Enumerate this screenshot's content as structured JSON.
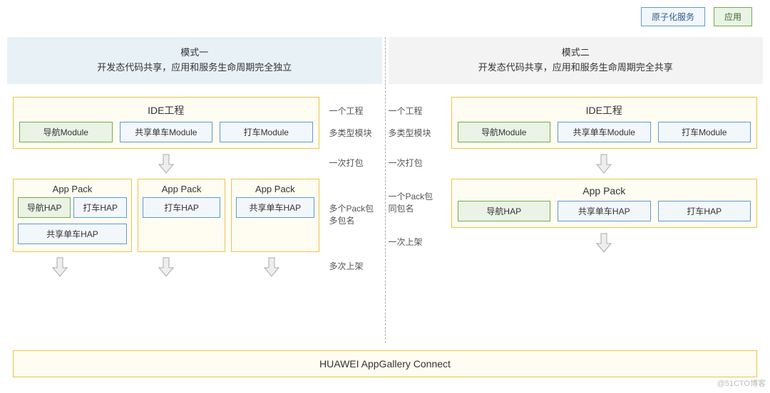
{
  "legend": {
    "atomic": "原子化服务",
    "app": "应用"
  },
  "left": {
    "mode_title": "模式一",
    "mode_desc": "开发态代码共享，应用和服务生命周期完全独立",
    "ide_title": "IDE工程",
    "modules": {
      "nav": "导航Module",
      "bike": "共享单车Module",
      "taxi": "打车Module"
    },
    "notes": {
      "one_project": "一个工程",
      "multi_module": "多类型模块",
      "one_build": "一次打包",
      "multi_pack": "多个Pack包多包名",
      "multi_publish": "多次上架"
    },
    "packs": {
      "p1_title": "App Pack",
      "p1_hap_nav": "导航HAP",
      "p1_hap_taxi": "打车HAP",
      "p1_hap_bike": "共享单车HAP",
      "p2_title": "App Pack",
      "p2_hap": "打车HAP",
      "p3_title": "App Pack",
      "p3_hap": "共享单车HAP"
    }
  },
  "right": {
    "mode_title": "模式二",
    "mode_desc": "开发态代码共享，应用和服务生命周期完全共享",
    "ide_title": "IDE工程",
    "modules": {
      "nav": "导航Module",
      "bike": "共享单车Module",
      "taxi": "打车Module"
    },
    "notes": {
      "one_project": "一个工程",
      "multi_module": "多类型模块",
      "one_build": "一次打包",
      "one_pack": "一个Pack包同包名",
      "one_publish": "一次上架"
    },
    "packs": {
      "title": "App Pack",
      "hap_nav": "导航HAP",
      "hap_bike": "共享单车HAP",
      "hap_taxi": "打车HAP"
    }
  },
  "footer": "HUAWEI AppGallery Connect",
  "watermark": "@51CTO博客"
}
